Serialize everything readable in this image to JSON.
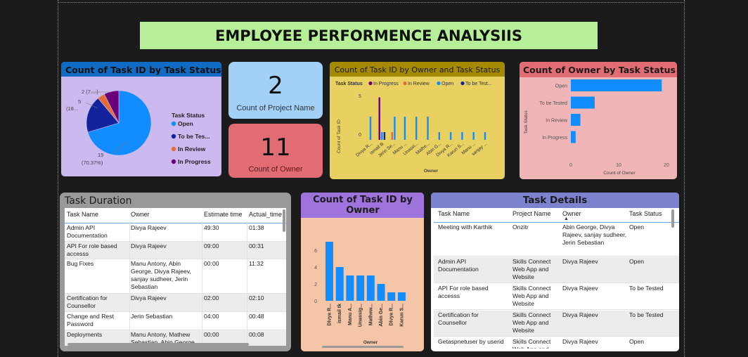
{
  "dashboard": {
    "title": "EMPLOYEE PERFORMENCE ANALYSIIS"
  },
  "colors": {
    "open": "#118DFF",
    "to_be_tested": "#12239E",
    "in_review": "#E66C37",
    "in_progress": "#6B007B"
  },
  "pie": {
    "title": "Count of Task ID by Task Status",
    "legend_title": "Task Status",
    "legend": [
      "Open",
      "To be Tes...",
      "In Review",
      "In Progress"
    ],
    "labels": {
      "in_progress": "2 (7....)",
      "to_be_tested": "5",
      "to_be_tested_pct": "(18...",
      "open": "19",
      "open_pct": "(70.37%)"
    },
    "chart_data": {
      "type": "pie",
      "categories": [
        "Open",
        "To be Tested",
        "In Review",
        "In Progress"
      ],
      "values": [
        19,
        5,
        1,
        2
      ]
    }
  },
  "kpi_projects": {
    "value": "2",
    "label": "Count of Project Name"
  },
  "kpi_owners": {
    "value": "11",
    "label": "Count of Owner"
  },
  "owner_status": {
    "title": "Count of Task ID by Owner and Task Status",
    "legend_title": "Task Status",
    "legend": [
      "In Progress",
      "In Review",
      "Open",
      "To be Test..."
    ],
    "ylabel": "Count of Task ID",
    "xlabel": "Owner",
    "yticks": [
      "5",
      "0"
    ],
    "xticks": [
      "Divya R...",
      "ismail tk",
      "Jerin Se...",
      "Manu ...",
      "Unassi...",
      "Mathe...",
      "Abin G...",
      "Divya R...",
      "Karun S...",
      "Manu ...",
      "sanjay ..."
    ],
    "chart_data": {
      "type": "bar",
      "categories": [
        "Divya R...",
        "ismail tk",
        "Jerin Se...",
        "Manu ...",
        "Unassi...",
        "Mathe...",
        "Abin G...",
        "Divya R...",
        "Karun S...",
        "Manu ...",
        "sanjay ..."
      ],
      "series": [
        {
          "name": "In Progress",
          "values": [
            0,
            5.5,
            0,
            0,
            0,
            0,
            0,
            0,
            0,
            0,
            0
          ]
        },
        {
          "name": "In Review",
          "values": [
            0,
            0,
            1,
            0,
            0,
            0,
            0,
            0,
            0,
            0,
            0
          ]
        },
        {
          "name": "Open",
          "values": [
            3,
            1,
            3,
            3,
            3,
            3,
            1,
            1,
            1,
            1,
            1
          ]
        },
        {
          "name": "To be Tested",
          "values": [
            0,
            1,
            0,
            0,
            0,
            0,
            0,
            0,
            0,
            0,
            0
          ]
        }
      ],
      "ylim": [
        0,
        6
      ]
    }
  },
  "owner_by_status": {
    "title": "Count of Owner by Task Status",
    "ylabel": "Task Status",
    "xlabel": "Count of Owner",
    "xticks": [
      "0",
      "10",
      "20"
    ],
    "chart_data": {
      "type": "bar",
      "categories": [
        "Open",
        "To be Tested",
        "In Review",
        "In Progress"
      ],
      "values": [
        19,
        5,
        2,
        1
      ],
      "xlim": [
        0,
        20
      ]
    }
  },
  "task_duration": {
    "title": "Task Duration",
    "columns": [
      "Task Name",
      "Owner",
      "Estimate time",
      "Actual_time"
    ],
    "rows": [
      [
        "Admin API Documentation",
        "Divya Rajeev",
        "49:30",
        "01:38"
      ],
      [
        "API For role based accesss",
        "Divya Rajeev",
        "09:00",
        "00:31"
      ],
      [
        "Bug Fixes",
        "Manu Antony, Abin George, Divya Rajeev, sanjay sudheer, Jerin Sebastian",
        "00:00",
        "11:32"
      ],
      [
        "Certification for Counsellor",
        "Divya Rajeev",
        "02:00",
        "02:10"
      ],
      [
        "Change and Rest Password",
        "Jerin Sebastian",
        "04:00",
        "00:48"
      ],
      [
        "Deployments",
        "Manu Antony, Mathew Sebastian, Abin George",
        "00:00",
        "00:08"
      ]
    ]
  },
  "owner_count": {
    "title": "Count of Task ID by Owner",
    "xlabel": "Owner",
    "yticks": [
      "6",
      "4",
      "2",
      "0"
    ],
    "chart_data": {
      "type": "bar",
      "categories": [
        "Divya R...",
        "ismail tk",
        "Manu A...",
        "Unassig...",
        "Mathew...",
        "Abin Ge...",
        "Divya R...",
        "Karun S..."
      ],
      "values": [
        7,
        4,
        3,
        3,
        3,
        2,
        1,
        1
      ],
      "ylim": [
        0,
        7.5
      ]
    }
  },
  "task_details": {
    "title": "Task Details",
    "columns": [
      "Task Name",
      "Project Name",
      "Owner",
      "Task Status"
    ],
    "rows": [
      [
        "Meeting with Karthik",
        "Onzitr",
        "Abin George, Divya Rajeev, sanjay sudheer, Jerin Sebastian",
        "Open"
      ],
      [
        "Admin API Documentation",
        "Skills Connect Web App and Website",
        "Divya Rajeev",
        "Open"
      ],
      [
        "API For role based accesss",
        "Skills Connect Web App and Website",
        "Divya Rajeev",
        "To be Tested"
      ],
      [
        "Certification for Counsellor",
        "Skills Connect Web App and Website",
        "Divya Rajeev",
        "To be Tested"
      ],
      [
        "Getaspnetuser by userid",
        "Skills Connect Web App and",
        "Divya Rajeev",
        "Open"
      ]
    ]
  }
}
